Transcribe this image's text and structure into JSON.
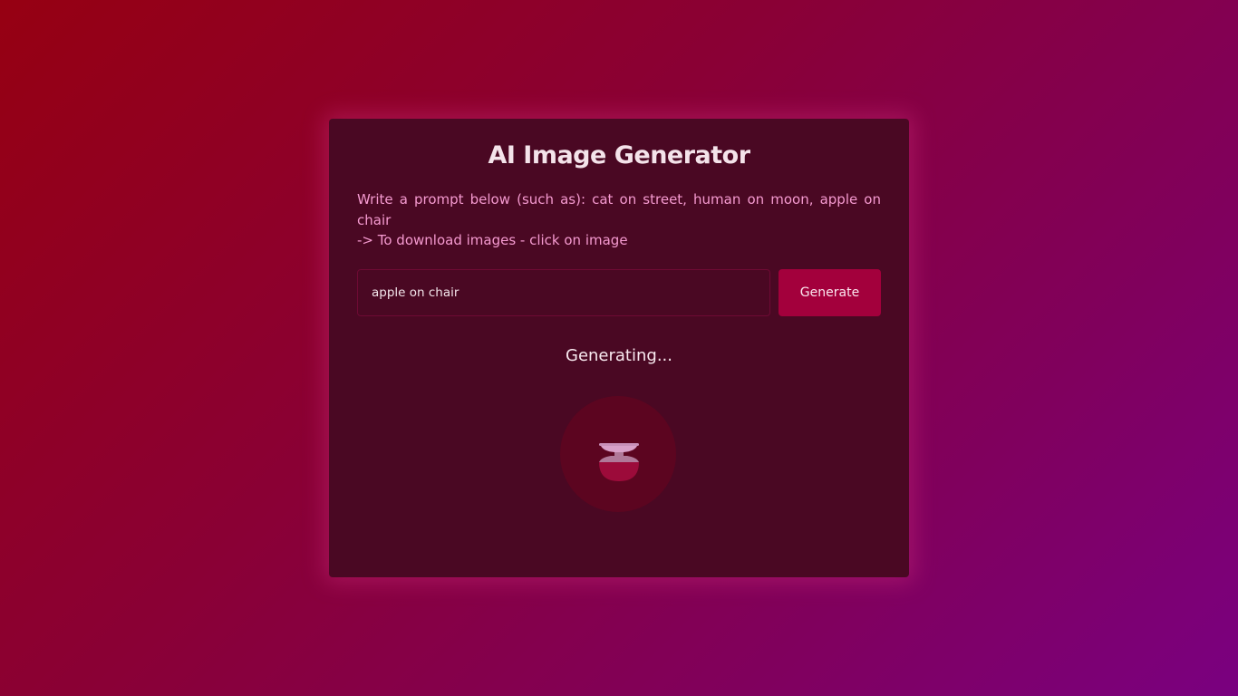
{
  "app": {
    "title": "AI Image Generator"
  },
  "instructions": {
    "line1": "Write a prompt below (such as): cat on street, human on moon, apple on chair",
    "line2": "-> To download images - click on image"
  },
  "form": {
    "prompt_value": "apple on chair",
    "prompt_placeholder": "",
    "generate_label": "Generate"
  },
  "status": {
    "text": "Generating..."
  },
  "loader": {
    "icon": "hourglass-icon"
  },
  "colors": {
    "background_start": "#960012",
    "background_end": "#7a0080",
    "card": "#4a0823",
    "accent": "#a3003c",
    "instruction_text": "#f59ad0"
  }
}
